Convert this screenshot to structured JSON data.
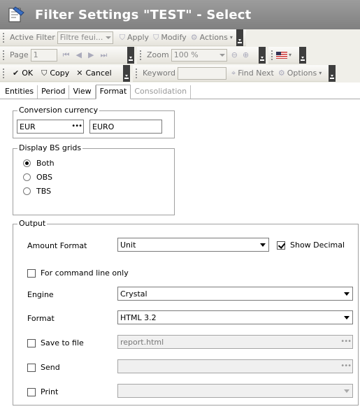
{
  "window": {
    "title": "Filter Settings \"TEST\" - Select"
  },
  "toolbar1": {
    "active_filter_label": "Active Filter",
    "active_filter_value": "Filtre feui...",
    "apply_label": "Apply",
    "modify_label": "Modify",
    "actions_label": "Actions"
  },
  "toolbar2": {
    "page_label": "Page",
    "page_value": "1",
    "zoom_label": "Zoom",
    "zoom_value": "100 %"
  },
  "toolbar3": {
    "ok_label": "OK",
    "copy_label": "Copy",
    "cancel_label": "Cancel",
    "keyword_label": "Keyword",
    "keyword_value": "",
    "find_next_label": "Find Next",
    "options_label": "Options"
  },
  "tabs": [
    "Entities",
    "Period",
    "View",
    "Format",
    "Consolidation"
  ],
  "active_tab": "Format",
  "conversion": {
    "label": "Conversion currency",
    "code": "EUR",
    "name": "EURO"
  },
  "bs_grids": {
    "label": "Display BS grids",
    "options": [
      "Both",
      "OBS",
      "TBS"
    ],
    "selected": "Both"
  },
  "output": {
    "label": "Output",
    "amount_format_label": "Amount Format",
    "amount_format_value": "Unit",
    "show_decimal_label": "Show Decimal",
    "show_decimal_checked": true,
    "command_line_label": "For command line only",
    "engine_label": "Engine",
    "engine_value": "Crystal",
    "format_label": "Format",
    "format_value": "HTML 3.2",
    "save_to_file_label": "Save to file",
    "save_to_file_value": "report.html",
    "send_label": "Send",
    "print_label": "Print"
  },
  "colors": {
    "title_bar": "#8c8c8c",
    "toolbar_end": "#3e3e3e"
  }
}
